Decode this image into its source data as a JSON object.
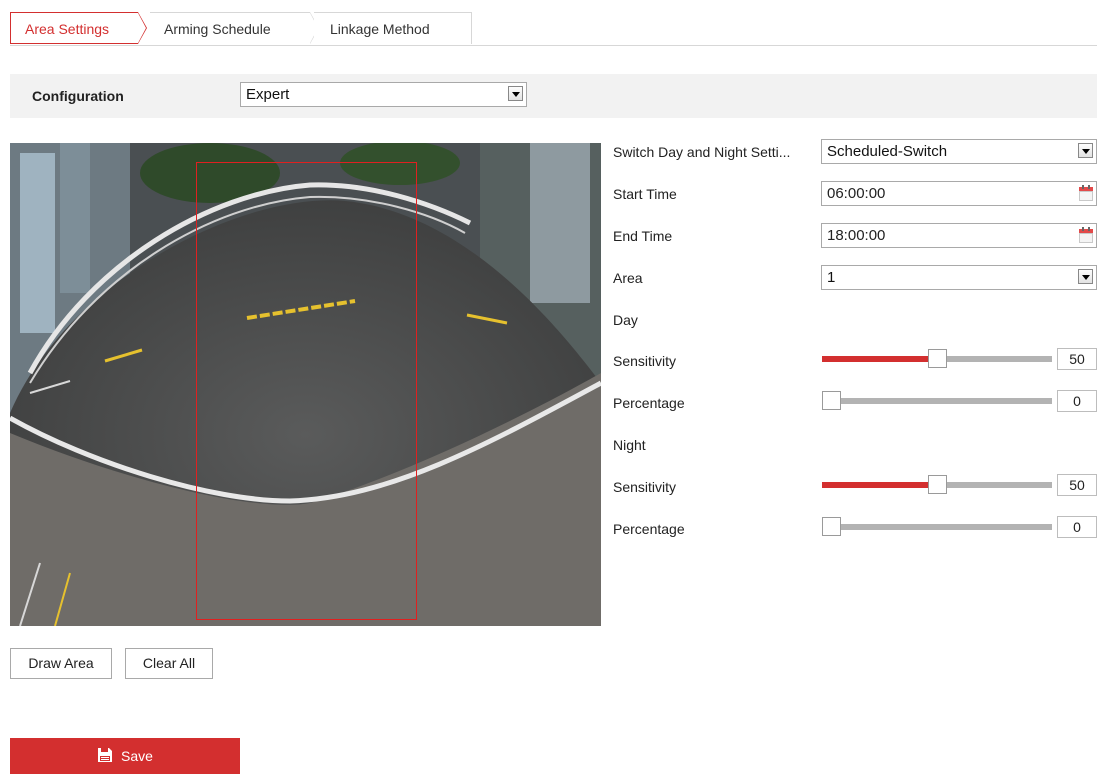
{
  "tabs": [
    {
      "label": "Area Settings",
      "active": true
    },
    {
      "label": "Arming Schedule",
      "active": false
    },
    {
      "label": "Linkage Method",
      "active": false
    }
  ],
  "configuration": {
    "label": "Configuration",
    "value": "Expert"
  },
  "video": {
    "description_icon": "camera-feed"
  },
  "settings": {
    "switch_day_night": {
      "label": "Switch Day and Night Setti...",
      "value": "Scheduled-Switch"
    },
    "start_time": {
      "label": "Start Time",
      "value": "06:00:00"
    },
    "end_time": {
      "label": "End Time",
      "value": "18:00:00"
    },
    "area": {
      "label": "Area",
      "value": "1"
    },
    "day": {
      "heading": "Day",
      "sensitivity": {
        "label": "Sensitivity",
        "value": "50"
      },
      "percentage": {
        "label": "Percentage",
        "value": "0"
      }
    },
    "night": {
      "heading": "Night",
      "sensitivity": {
        "label": "Sensitivity",
        "value": "50"
      },
      "percentage": {
        "label": "Percentage",
        "value": "0"
      }
    }
  },
  "buttons": {
    "draw_area": "Draw Area",
    "clear_all": "Clear All",
    "save": "Save"
  },
  "colors": {
    "accent": "#d32f2f",
    "area_outline": "#e02020",
    "slider_track": "#b3b3b3"
  }
}
